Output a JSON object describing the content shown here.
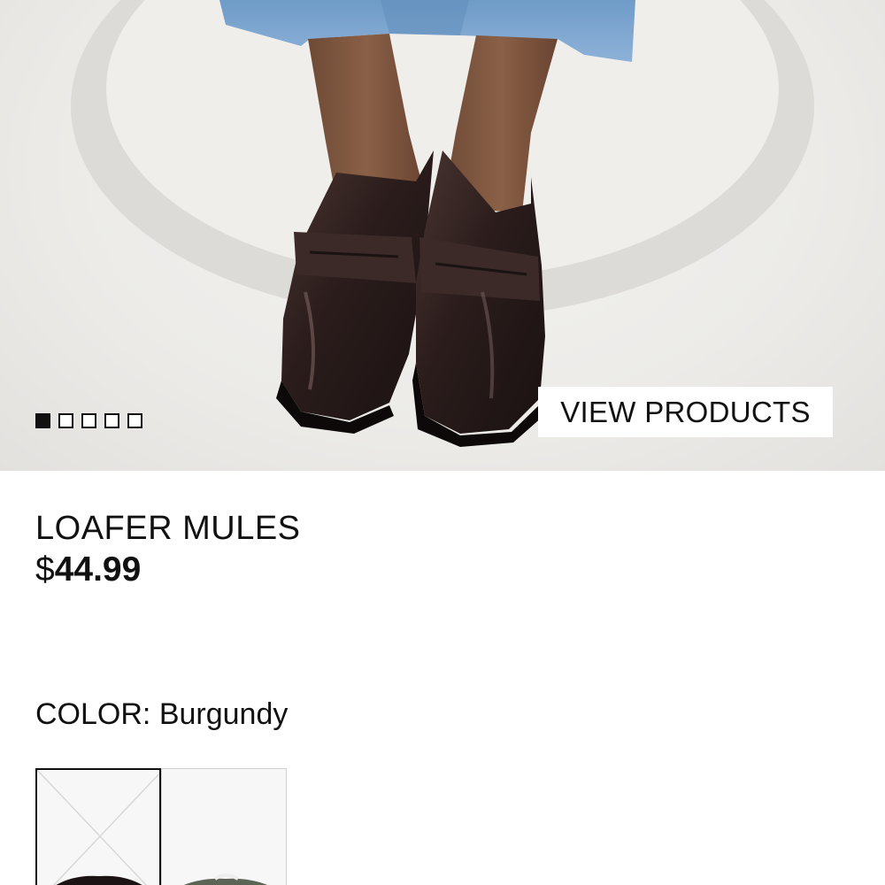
{
  "hero": {
    "cta_label": "VIEW PRODUCTS",
    "carousel": {
      "count": 5,
      "active_index": 0
    }
  },
  "product": {
    "title": "LOAFER MULES",
    "price_currency": "$",
    "price_value": "44.99",
    "color_label": "COLOR:",
    "color_value": "Burgundy"
  },
  "swatches": [
    {
      "name": "Burgundy",
      "selected": true
    },
    {
      "name": "Green",
      "selected": false
    }
  ],
  "colors": {
    "text": "#111111",
    "background": "#ffffff",
    "denim": "#7ea6cf",
    "shoe": "#2a1d1c"
  }
}
